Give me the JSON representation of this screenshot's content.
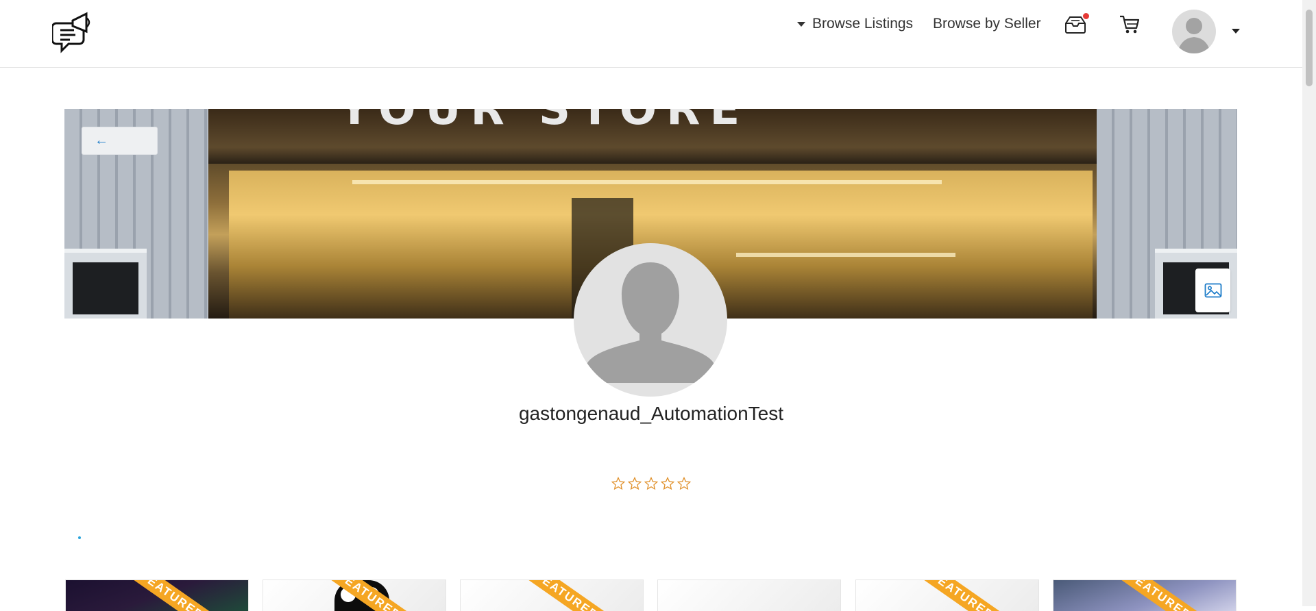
{
  "header": {
    "browse_listings": "Browse Listings",
    "browse_by_seller": "Browse by Seller",
    "inbox_has_notification": true
  },
  "banner": {
    "back_arrow": "←",
    "storefront_letters": "YOUR STORE"
  },
  "profile": {
    "username": "gastongenaud_AutomationTest",
    "rating": 0,
    "rating_max": 5
  },
  "listings": {
    "cards": [
      {
        "ribbon": "FEATURED",
        "thumb": "aurora"
      },
      {
        "ribbon": "FEATURED",
        "thumb": "penguin"
      },
      {
        "ribbon": "FEATURED",
        "thumb": "plain"
      },
      {
        "ribbon": "",
        "thumb": "plain"
      },
      {
        "ribbon": "FEATURED",
        "thumb": "plain"
      },
      {
        "ribbon": "FEATURED",
        "thumb": "fabric"
      }
    ]
  },
  "colors": {
    "accent_star": "#e0902a",
    "link_blue": "#1a7ac8",
    "ribbon": "#f5a623",
    "notification": "#e53935"
  },
  "icons": [
    "logo-megaphone-chat-icon",
    "caret-down-icon",
    "inbox-icon",
    "cart-icon",
    "user-avatar-icon",
    "back-arrow-icon",
    "image-icon",
    "star-outline-icon"
  ]
}
